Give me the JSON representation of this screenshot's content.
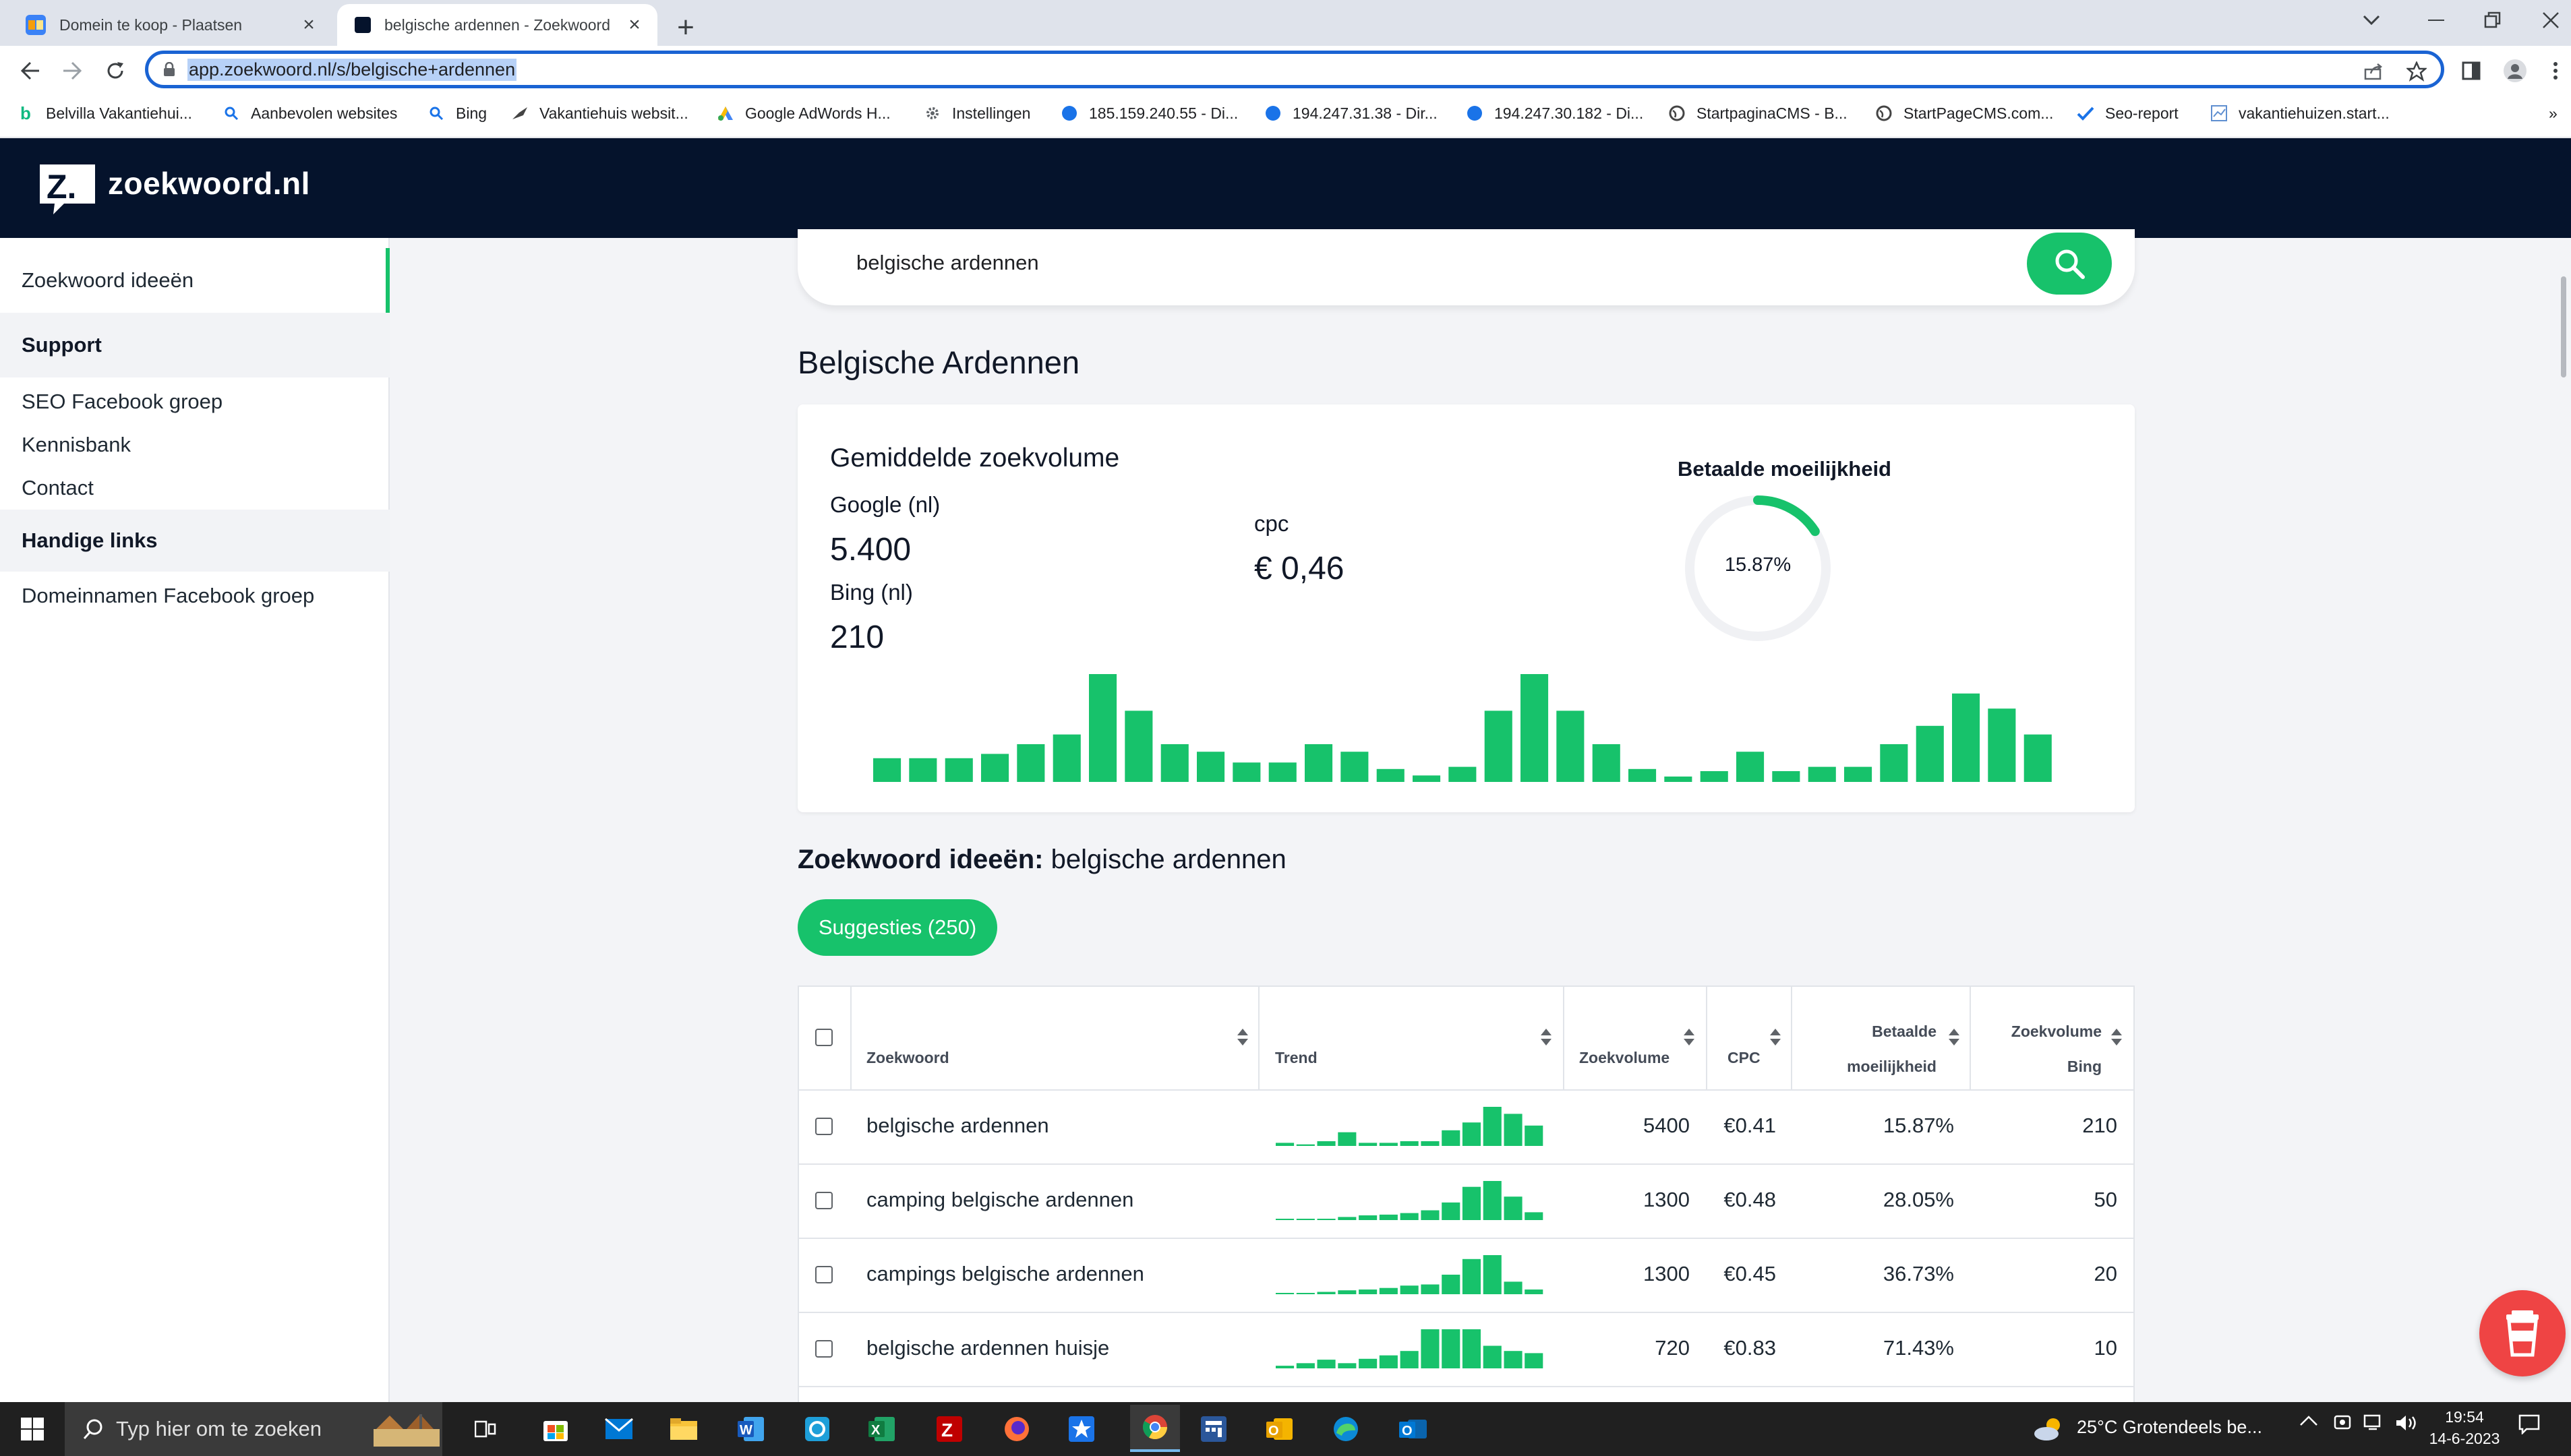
{
  "browser": {
    "tabs": [
      {
        "title": "Domein te koop - Plaatsen",
        "active": false
      },
      {
        "title": "belgische ardennen - Zoekwoord",
        "active": true
      }
    ],
    "url": "app.zoekwoord.nl/s/belgische+ardennen",
    "bookmarks": [
      "Belvilla Vakantiehui...",
      "Aanbevolen websites",
      "Bing",
      "Vakantiehuis websit...",
      "Google AdWords H...",
      "Instellingen",
      "185.159.240.55 - Di...",
      "194.247.31.38 - Dir...",
      "194.247.30.182 - Di...",
      "StartpaginaCMS - B...",
      "StartPageCMS.com...",
      "Seo-report",
      "vakantiehuizen.start..."
    ],
    "bookmarks_overflow": "»"
  },
  "site": {
    "logo_text": "zoekwoord.nl",
    "logo_letter": "Z."
  },
  "sidebar": {
    "active_item": "Zoekwoord ideeën",
    "sections": [
      {
        "heading": "Support",
        "items": [
          "SEO Facebook groep",
          "Kennisbank",
          "Contact"
        ]
      },
      {
        "heading": "Handige links",
        "items": [
          "Domeinnamen Facebook groep"
        ]
      }
    ]
  },
  "search": {
    "value": "belgische ardennen"
  },
  "page_title": "Belgische Ardennen",
  "stats": {
    "heading": "Gemiddelde zoekvolume",
    "google_label": "Google (nl)",
    "google_value": "5.400",
    "bing_label": "Bing (nl)",
    "bing_value": "210",
    "cpc_label": "cpc",
    "cpc_value": "€ 0,46",
    "difficulty_label": "Betaalde moeilijkheid",
    "difficulty_value": "15.87%",
    "difficulty_fraction": 0.1587
  },
  "chart_data": {
    "type": "bar",
    "values": [
      22,
      22,
      22,
      26,
      35,
      44,
      100,
      66,
      35,
      28,
      18,
      18,
      35,
      28,
      12,
      6,
      14,
      66,
      100,
      66,
      35,
      12,
      5,
      10,
      28,
      10,
      14,
      14,
      35,
      52,
      82,
      68,
      44
    ]
  },
  "ideas": {
    "heading_bold": "Zoekwoord ideeën:",
    "heading_query": "belgische ardennen",
    "suggestions_button": "Suggesties (250)"
  },
  "table": {
    "columns": [
      "Zoekwoord",
      "Trend",
      "Zoekvolume",
      "CPC",
      "Betaalde moeilijkheid",
      "Zoekvolume Bing"
    ],
    "columns_line1": {
      "difficulty": "Betaalde",
      "bing": "Zoekvolume"
    },
    "columns_line2": {
      "difficulty": "moeilijkheid",
      "bing": "Bing"
    },
    "rows": [
      {
        "keyword": "belgische ardennen",
        "volume": "5400",
        "cpc": "€0.41",
        "difficulty": "15.87%",
        "bing": "210",
        "trend": [
          8,
          4,
          12,
          35,
          8,
          8,
          12,
          12,
          40,
          60,
          100,
          82,
          52
        ]
      },
      {
        "keyword": "camping belgische ardennen",
        "volume": "1300",
        "cpc": "€0.48",
        "difficulty": "28.05%",
        "bing": "50",
        "trend": [
          3,
          3,
          3,
          8,
          12,
          14,
          18,
          25,
          45,
          85,
          100,
          60,
          20
        ]
      },
      {
        "keyword": "campings belgische ardennen",
        "volume": "1300",
        "cpc": "€0.45",
        "difficulty": "36.73%",
        "bing": "20",
        "trend": [
          3,
          3,
          6,
          10,
          12,
          16,
          22,
          25,
          50,
          90,
          100,
          32,
          12
        ]
      },
      {
        "keyword": "belgische ardennen huisje",
        "volume": "720",
        "cpc": "€0.83",
        "difficulty": "71.43%",
        "bing": "10",
        "trend": [
          6,
          12,
          20,
          12,
          22,
          30,
          40,
          90,
          90,
          90,
          52,
          40,
          35
        ]
      }
    ]
  },
  "taskbar": {
    "search_placeholder": "Typ hier om te zoeken",
    "weather": "25°C  Grotendeels be...",
    "time": "19:54",
    "date": "14-6-2023"
  },
  "colors": {
    "brand_green": "#17c26b",
    "header_navy": "#05132c",
    "accent_red": "#ef4444"
  }
}
